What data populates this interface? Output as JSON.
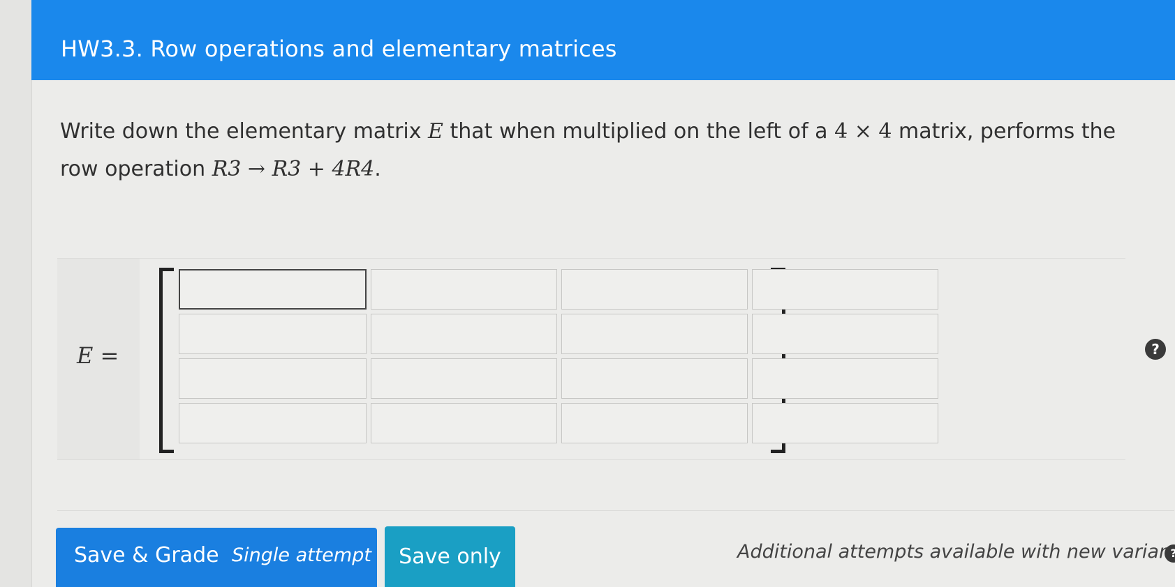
{
  "header": {
    "title": "HW3.3. Row operations and elementary matrices"
  },
  "question": {
    "text_before": "Write down the elementary matrix ",
    "matrix_symbol": "E",
    "text_mid": " that when multiplied on the left of a ",
    "size": "4 × 4",
    "text_after": " matrix, performs the row operation ",
    "operation": "R3 → R3 + 4R4",
    "end": "."
  },
  "answer": {
    "label": "E =",
    "matrix": [
      [
        "",
        "",
        "",
        ""
      ],
      [
        "",
        "",
        "",
        ""
      ],
      [
        "",
        "",
        "",
        ""
      ],
      [
        "",
        "",
        "",
        ""
      ]
    ]
  },
  "icons": {
    "help": "question-circle-icon",
    "info": "info-circle-icon"
  },
  "actions": {
    "grade_label": "Save & Grade",
    "grade_sub": "Single attempt",
    "save_label": "Save only",
    "attempts_note": "Additional attempts available with new variants"
  },
  "colors": {
    "header_bg": "#1a88ec",
    "grade_button": "#1a7fe0",
    "save_button": "#1a9fc4"
  }
}
